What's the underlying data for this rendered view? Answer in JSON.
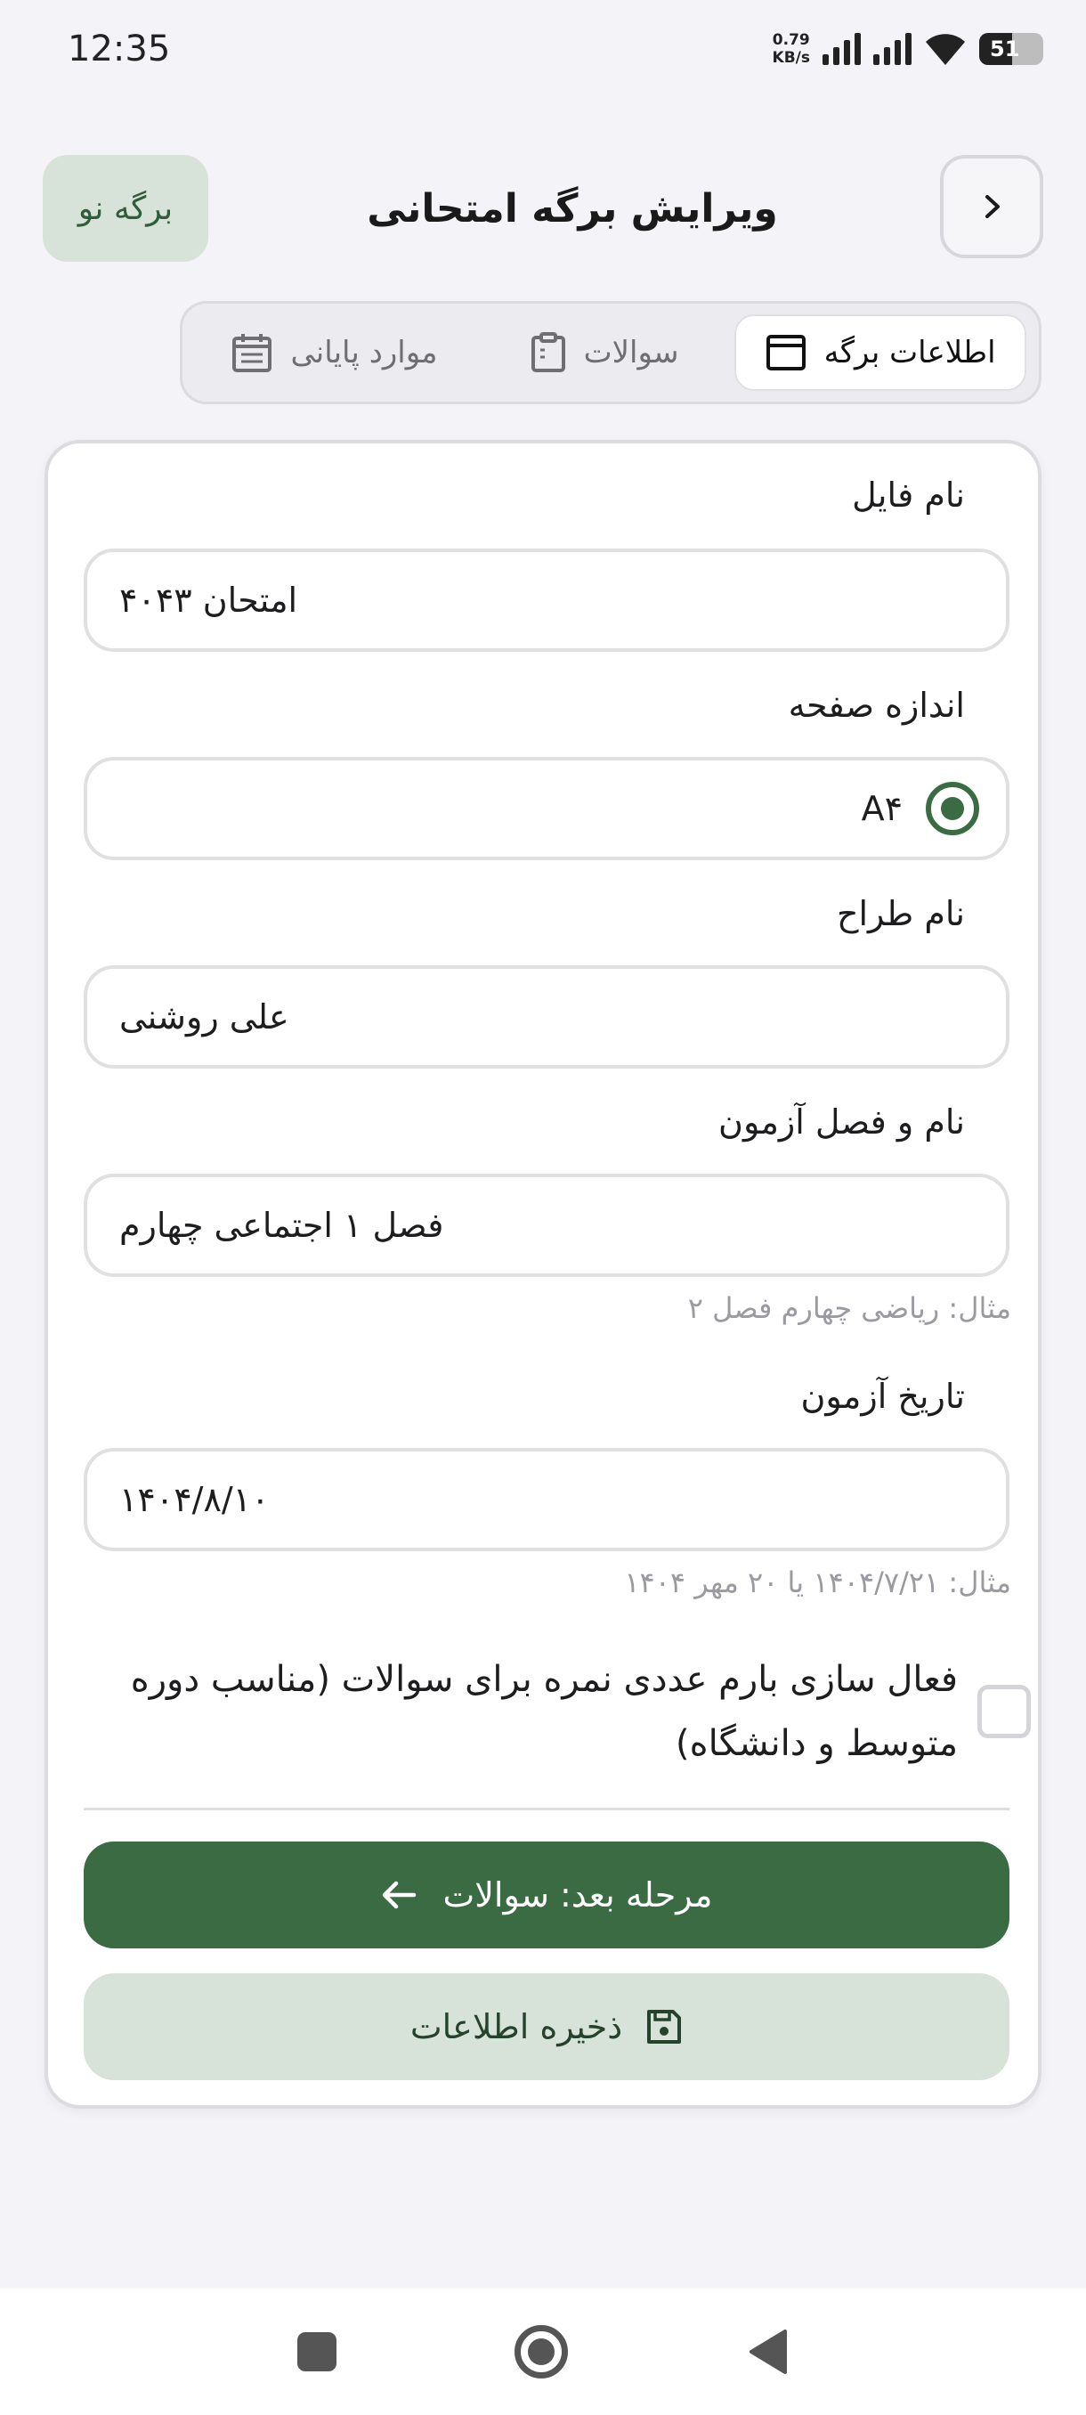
{
  "status_bar": {
    "time": "12:35",
    "net_speed_value": "0.79",
    "net_speed_unit": "KB/s",
    "battery_level": "51",
    "icons": [
      "signal-icon",
      "signal-icon",
      "wifi-icon",
      "battery-icon"
    ]
  },
  "header": {
    "title": "ویرایش برگه امتحانی",
    "new_sheet_label": "برگه نو",
    "back_icon": "chevron-right-icon"
  },
  "tabs": [
    {
      "label": "اطلاعات برگه",
      "icon": "window-icon",
      "active": true
    },
    {
      "label": "سوالات",
      "icon": "clipboard-icon",
      "active": false
    },
    {
      "label": "موارد پایانی",
      "icon": "calendar-icon",
      "active": false
    }
  ],
  "form": {
    "file_name_label": "نام فایل",
    "file_name_value": "امتحان ۴۰۴۳",
    "page_size_label": "اندازه صفحه",
    "page_size_value": "A۴",
    "designer_label": "نام طراح",
    "designer_value": "علی روشنی",
    "exam_name_label": "نام و فصل آزمون",
    "exam_name_value": "فصل ۱ اجتماعی چهارم",
    "exam_name_hint": "مثال: ریاضی چهارم فصل ۲",
    "exam_date_label": "تاریخ آزمون",
    "exam_date_value": "۱۴۰۴/۸/۱۰",
    "exam_date_hint": "مثال: ۱۴۰۴/۷/۲۱ یا ۲۰ مهر ۱۴۰۴",
    "numeric_score_label": "فعال سازی بارم عددی نمره برای سوالات (مناسب دوره متوسط و دانشگاه)",
    "numeric_score_checked": false
  },
  "actions": {
    "next_label": "مرحله بعد: سوالات",
    "save_label": "ذخیره اطلاعات"
  },
  "colors": {
    "primary": "#3a6b42",
    "primary_container": "#d7e3d9",
    "background": "#f4f3f7"
  }
}
